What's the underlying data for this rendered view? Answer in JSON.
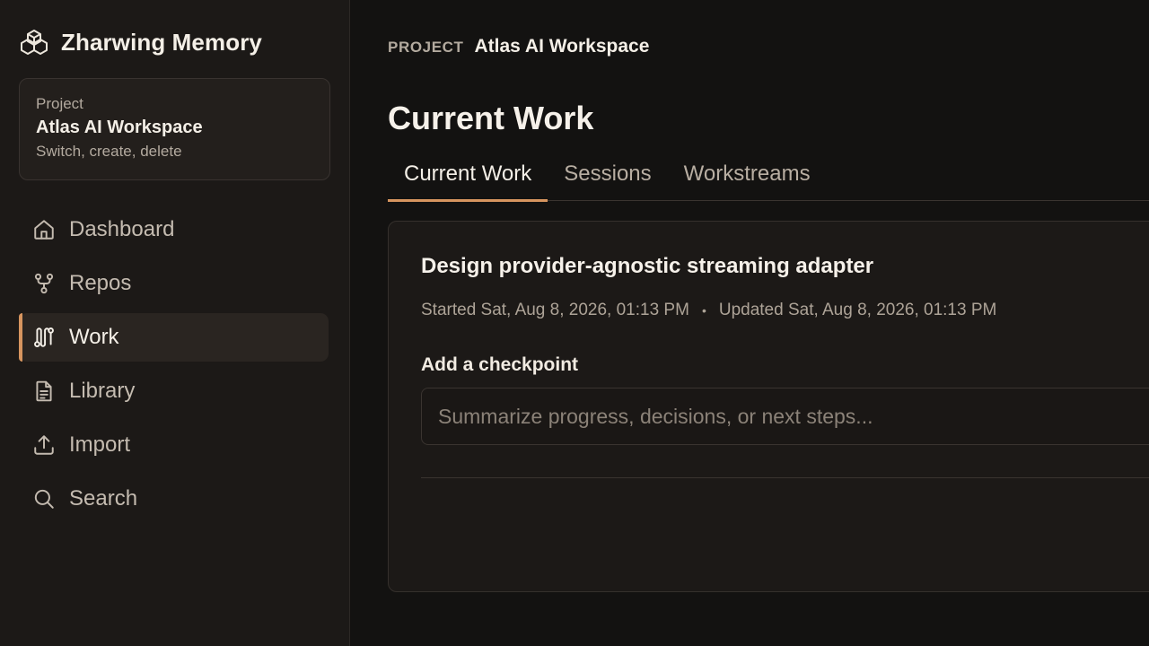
{
  "app": {
    "name": "Zharwing Memory"
  },
  "project_card": {
    "label": "Project",
    "title": "Atlas AI Workspace",
    "subtitle": "Switch, create, delete"
  },
  "nav": {
    "items": [
      {
        "label": "Dashboard",
        "icon": "home-icon"
      },
      {
        "label": "Repos",
        "icon": "git-fork-icon"
      },
      {
        "label": "Work",
        "icon": "workflow-icon",
        "active": true
      },
      {
        "label": "Library",
        "icon": "document-icon"
      },
      {
        "label": "Import",
        "icon": "upload-icon"
      },
      {
        "label": "Search",
        "icon": "search-icon"
      }
    ]
  },
  "breadcrumb": {
    "key": "PROJECT",
    "value": "Atlas AI Workspace"
  },
  "page": {
    "title": "Current Work"
  },
  "tabs": [
    {
      "label": "Current Work",
      "active": true
    },
    {
      "label": "Sessions"
    },
    {
      "label": "Workstreams"
    }
  ],
  "work_card": {
    "title": "Design provider-agnostic streaming adapter",
    "started": "Started Sat, Aug 8, 2026, 01:13 PM",
    "separator": "•",
    "updated": "Updated Sat, Aug 8, 2026, 01:13 PM",
    "checkpoint_label": "Add a checkpoint",
    "checkpoint_placeholder": "Summarize progress, decisions, or next steps...",
    "checkpoint_value": ""
  },
  "colors": {
    "accent": "#d7955f",
    "background": "#131211",
    "sidebar": "#1c1917"
  }
}
